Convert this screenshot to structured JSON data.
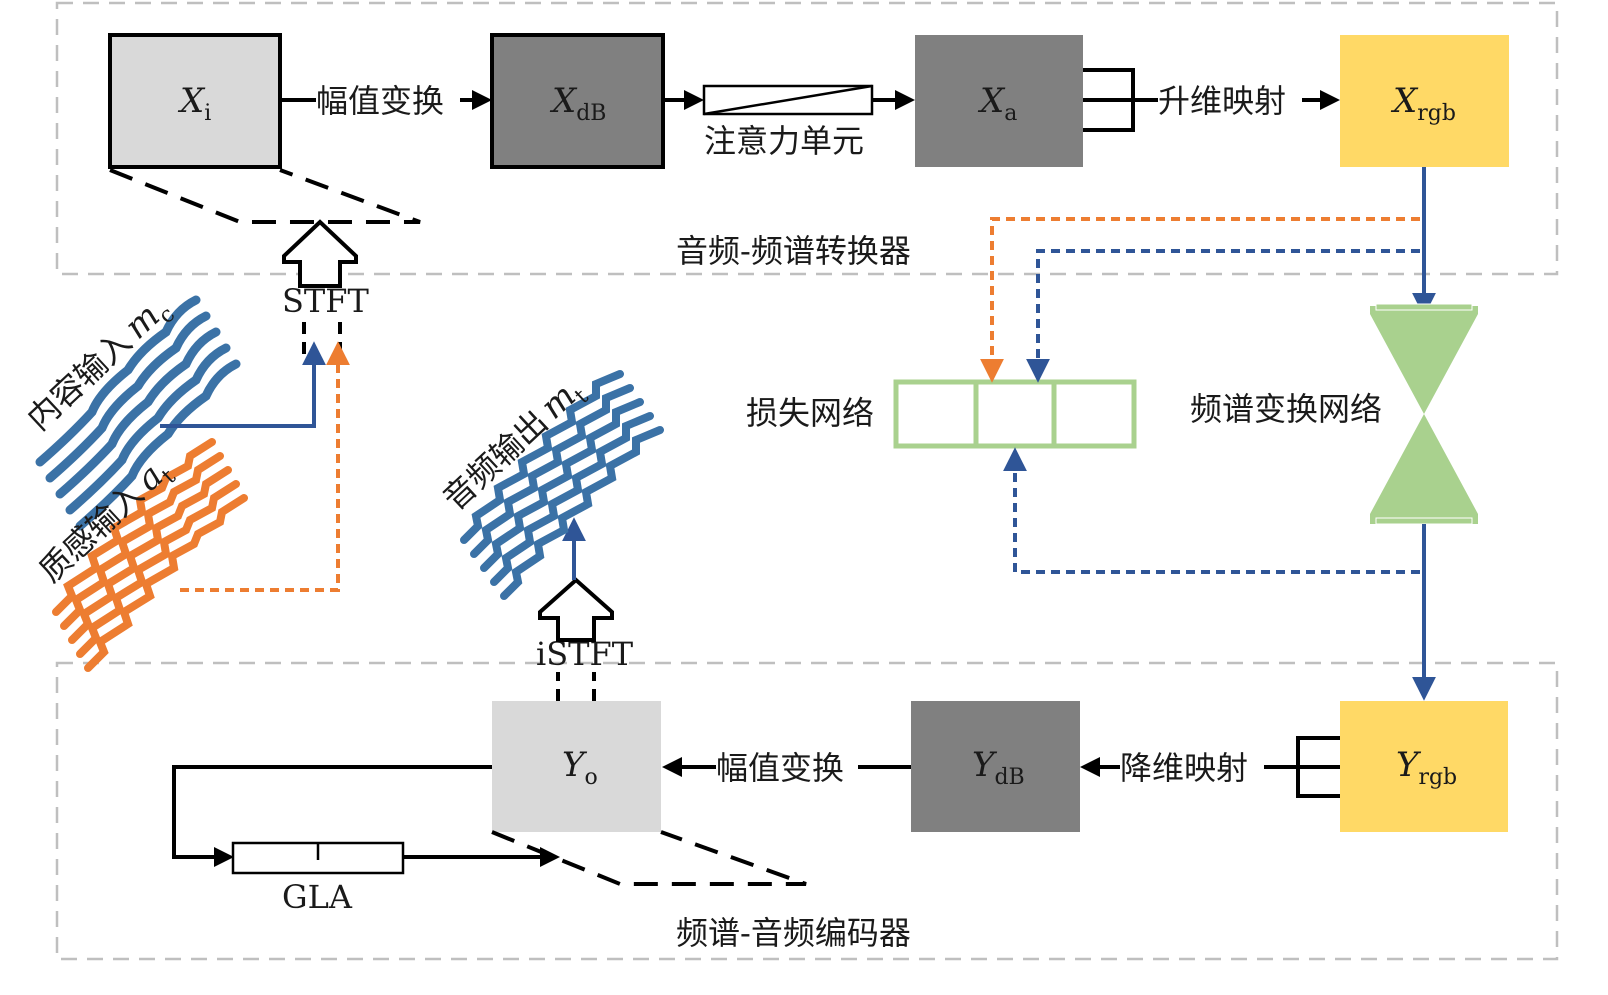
{
  "colors": {
    "gray_light": "#d9d9d9",
    "gray_dark": "#808080",
    "gold": "#ffd966",
    "green": "#a9d18e",
    "blue": "#2f5597",
    "wave_blue": "#3b72a6",
    "orange": "#ed7d31",
    "dash_gray": "#bfbfbf",
    "line": "#000000"
  },
  "groups": {
    "encoder": "音频-频谱转换器",
    "decoder": "频谱-音频编码器"
  },
  "blocks": {
    "xi": {
      "base": "X",
      "sub": "i"
    },
    "xdb": {
      "base": "X",
      "sub": "dB"
    },
    "xa": {
      "base": "X",
      "sub": "a"
    },
    "xrgb": {
      "base": "X",
      "sub": "rgb"
    },
    "yo": {
      "base": "Y",
      "sub": "o"
    },
    "ydb": {
      "base": "Y",
      "sub": "dB"
    },
    "yrgb": {
      "base": "Y",
      "sub": "rgb"
    }
  },
  "edges": {
    "amp_transform_top": "幅值变换",
    "attention_unit": "注意力单元",
    "dim_up": "升维映射",
    "amp_transform_bottom": "幅值变换",
    "dim_down": "降维映射"
  },
  "modules": {
    "loss_net": "损失网络",
    "spec_net": "频谱变换网络",
    "stft": "STFT",
    "istft": "iSTFT",
    "gla": "GLA"
  },
  "signals": {
    "content": {
      "label": "内容输入",
      "var": "m",
      "sub": "c"
    },
    "texture": {
      "label": "质感输入",
      "var": "a",
      "sub": "t"
    },
    "output": {
      "label": "音频输出",
      "var": "m",
      "sub": "t"
    }
  }
}
